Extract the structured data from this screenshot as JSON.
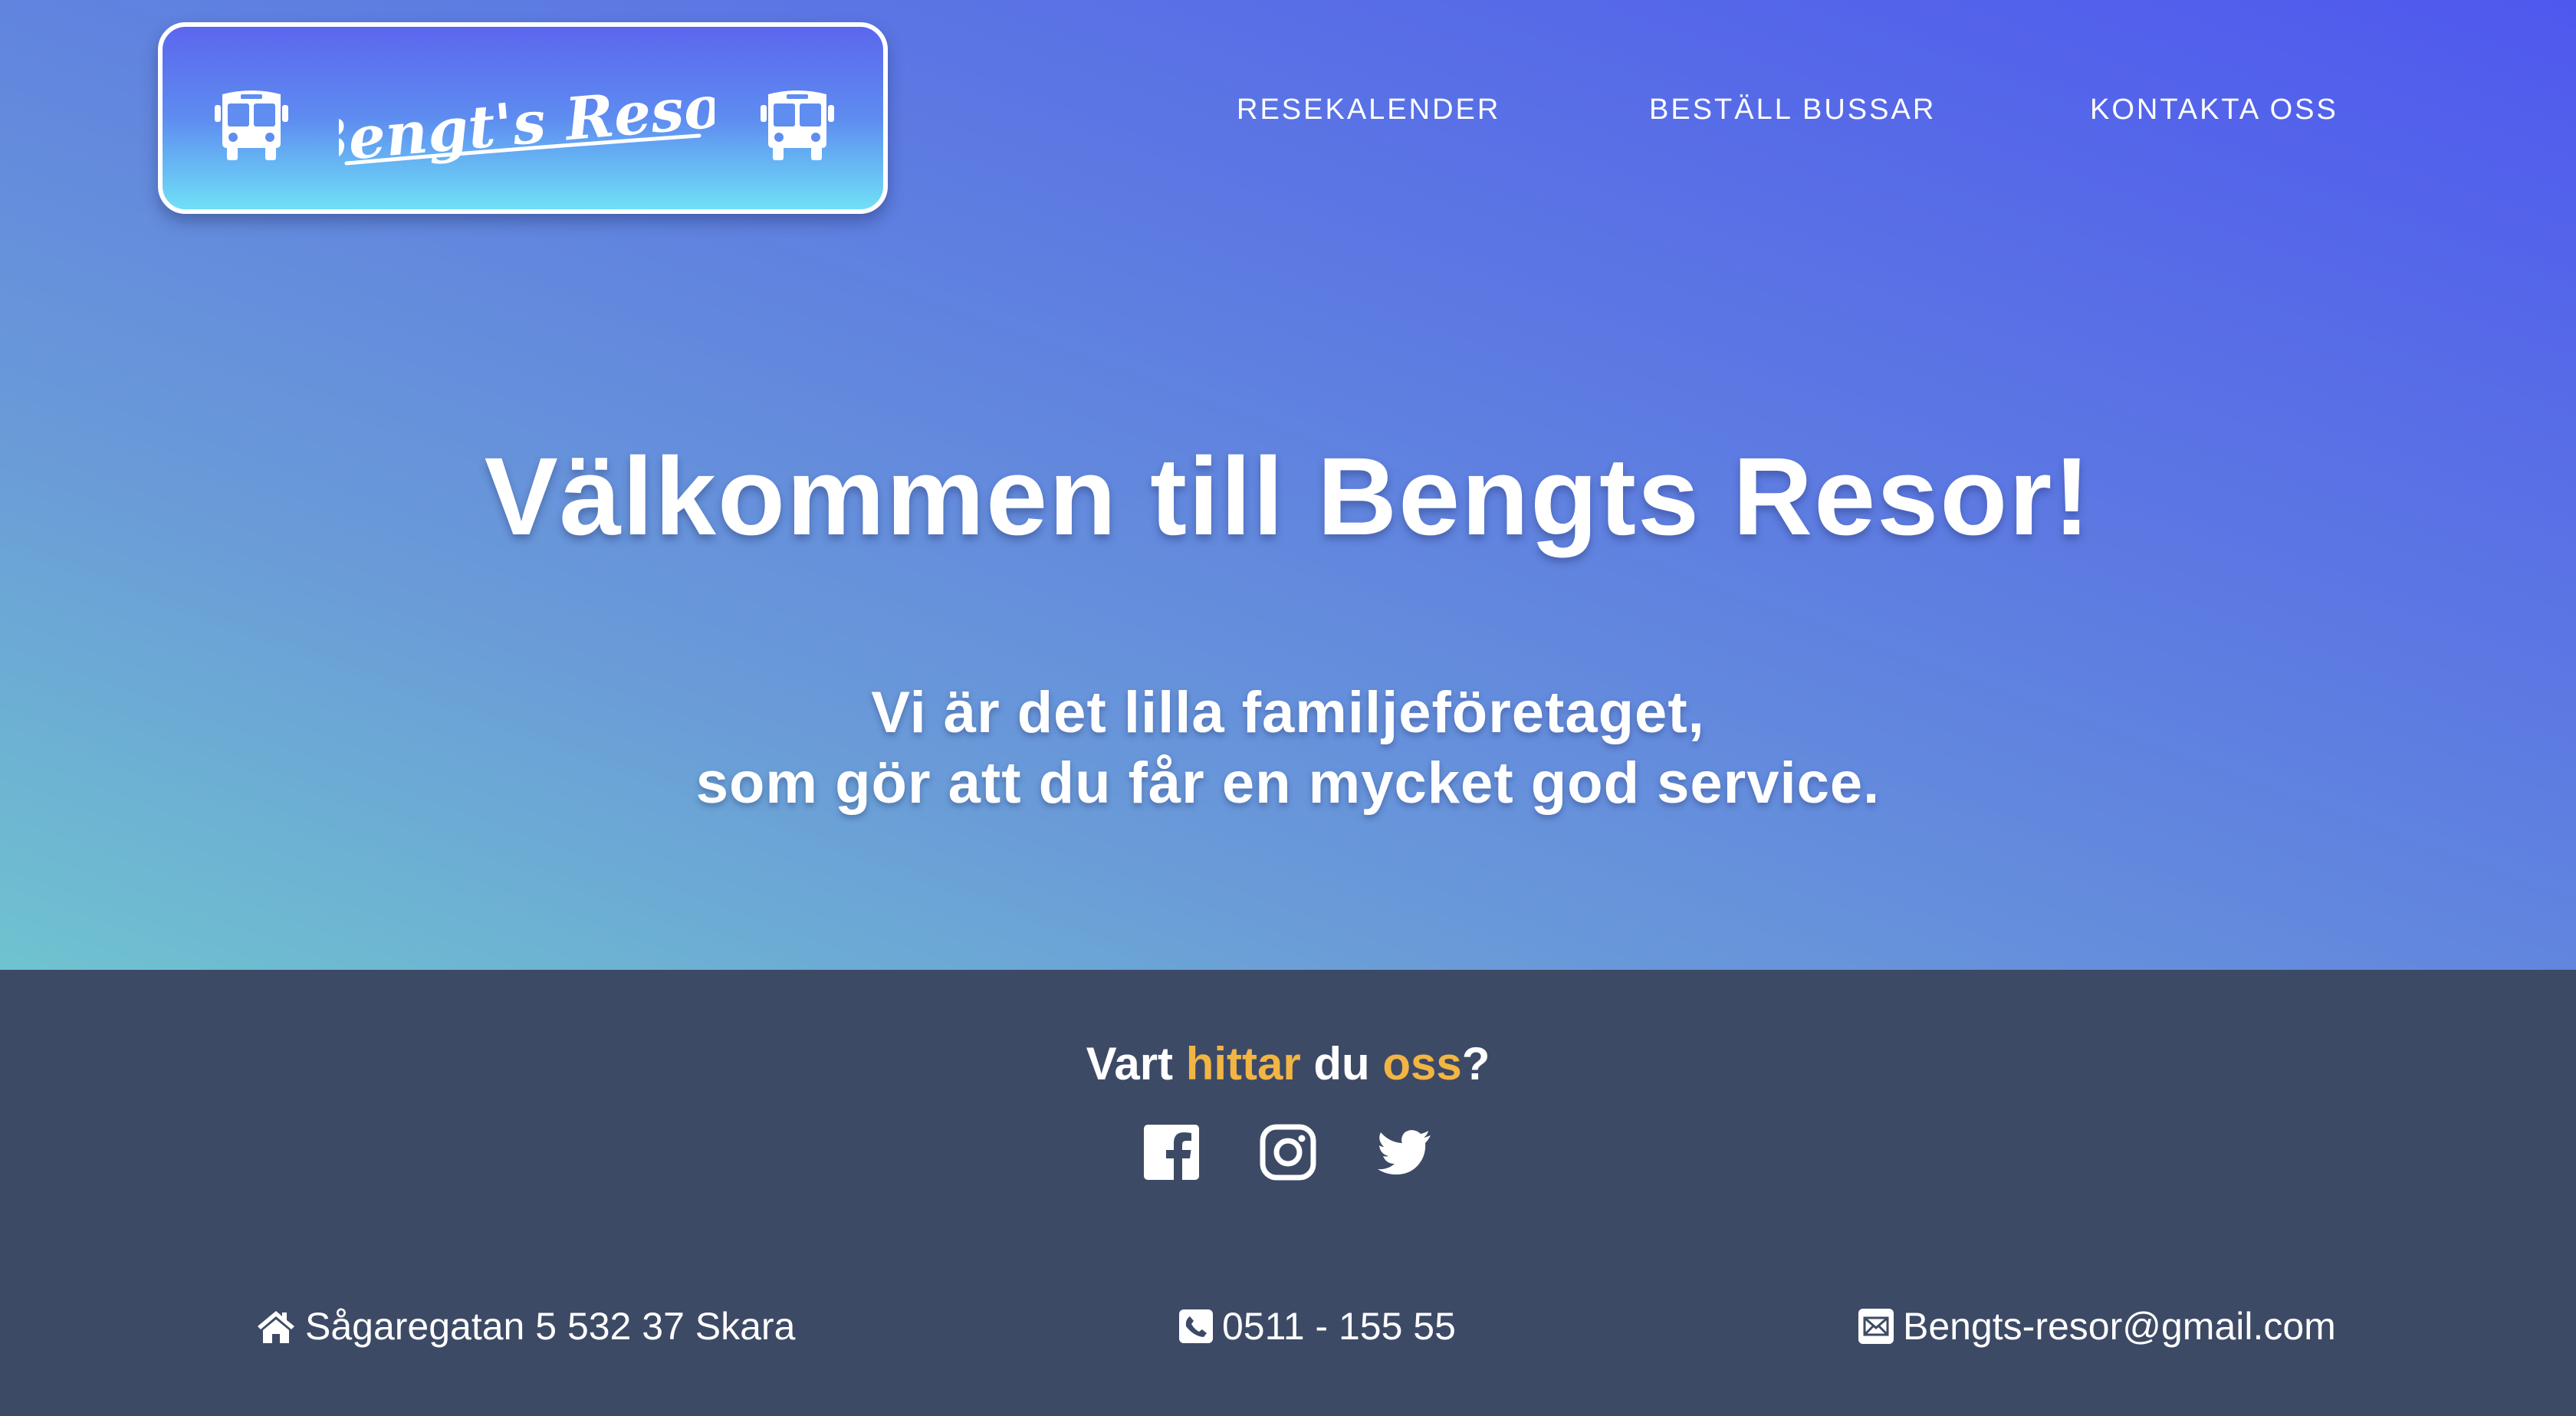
{
  "header": {
    "logo": {
      "text": "Bengt's Resor",
      "icons": [
        "bus-icon",
        "bus-icon"
      ]
    },
    "nav": [
      {
        "label": "RESEKALENDER"
      },
      {
        "label": "BESTÄLL BUSSAR"
      },
      {
        "label": "KONTAKTA OSS"
      }
    ]
  },
  "hero": {
    "title": "Välkommen till Bengts Resor!",
    "subtitle_line1": "Vi är det lilla familjeföretaget,",
    "subtitle_line2": "som gör att du får en mycket god service."
  },
  "footer": {
    "heading": {
      "part1": "Vart ",
      "part2": "hittar",
      "part3": " du ",
      "part4": "oss",
      "part5": "?"
    },
    "social": [
      {
        "icon": "facebook-icon"
      },
      {
        "icon": "instagram-icon"
      },
      {
        "icon": "twitter-icon"
      }
    ],
    "address": "Sågaregatan 5 532 37 Skara",
    "phone": "0511 - 155 55",
    "email": "Bengts-resor@gmail.com"
  },
  "colors": {
    "accent": "#f2b544",
    "footer_bg": "#3d4a66",
    "hero_gradient_start": "#6fc3cf",
    "hero_gradient_end": "#4f58ee",
    "text": "#ffffff"
  }
}
